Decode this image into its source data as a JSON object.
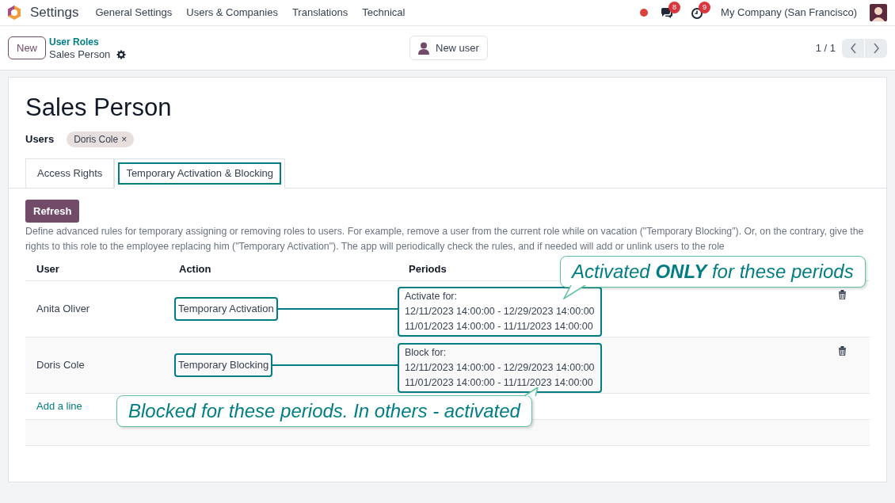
{
  "navbar": {
    "app": "Settings",
    "menu": [
      "General Settings",
      "Users & Companies",
      "Translations",
      "Technical"
    ],
    "messages_badge": "8",
    "activities_badge": "9",
    "company": "My Company (San Francisco)"
  },
  "control_panel": {
    "new_button": "New",
    "breadcrumb": "User Roles",
    "record": "Sales Person",
    "action_button": "New user",
    "pager": "1 / 1"
  },
  "form": {
    "title": "Sales Person",
    "users_label": "Users",
    "user_tags": [
      {
        "label": "Doris Cole",
        "remove": "×"
      }
    ],
    "tabs": [
      {
        "label": "Access Rights",
        "selected": false,
        "highlighted": false
      },
      {
        "label": "Temporary Activation & Blocking",
        "selected": true,
        "highlighted": true
      }
    ],
    "refresh_button": "Refresh",
    "description": "Define advanced rules for temporary assigning or removing roles to users. For example, remove a user from the current role while on vacation (\"Temporary Blocking\"). Or, on the contrary, give the rights to this role to the employee replacing him (\"Temporary Activation\"). The app will periodically check the rules, and if needed will add or unlink users to the role",
    "table": {
      "columns": [
        "User",
        "Action",
        "Periods"
      ],
      "rows": [
        {
          "user": "Anita Oliver",
          "action": "Temporary Activation",
          "periods_label": "Activate for:",
          "periods": [
            "12/11/2023 14:00:00 - 12/29/2023 14:00:00",
            "11/01/2023 14:00:00 - 11/11/2023 14:00:00"
          ],
          "highlighted": true
        },
        {
          "user": "Doris Cole",
          "action": "Temporary Blocking",
          "periods_label": "Block for:",
          "periods": [
            "12/11/2023 14:00:00 - 12/29/2023 14:00:00",
            "11/01/2023 14:00:00 - 11/11/2023 14:00:00"
          ],
          "highlighted": true
        }
      ],
      "add_line": "Add a line"
    }
  },
  "annotations": [
    {
      "text": "Activated **ONLY** for these periods",
      "kind": "tail-down"
    },
    {
      "text": "Blocked for these periods. In others - activated",
      "kind": "tail-up"
    }
  ]
}
